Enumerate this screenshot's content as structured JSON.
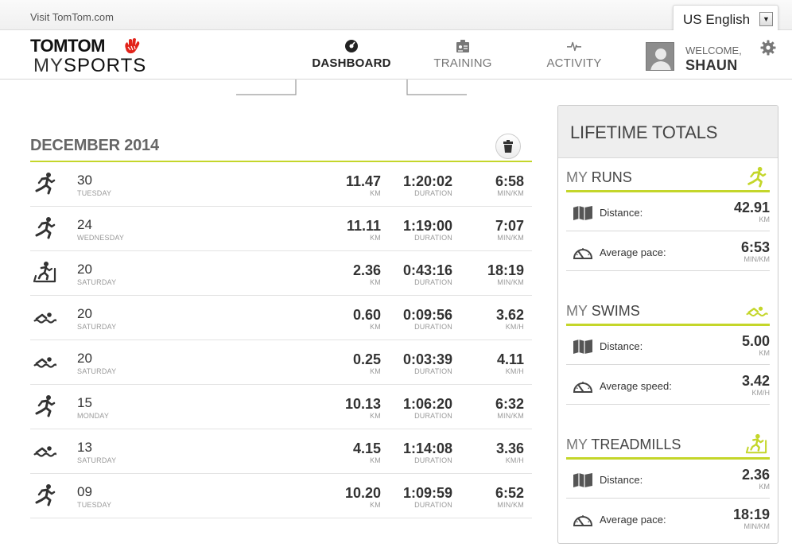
{
  "topbar": {
    "visit_link": "Visit TomTom.com",
    "language": "US English"
  },
  "logo": {
    "brand": "TOMTOM",
    "product_prefix": "MY",
    "product_suffix": "SPORTS"
  },
  "nav": {
    "tabs": [
      {
        "label": "DASHBOARD",
        "icon": "dashboard-icon",
        "active": true
      },
      {
        "label": "TRAINING",
        "icon": "training-icon",
        "active": false
      },
      {
        "label": "ACTIVITY",
        "icon": "activity-icon",
        "active": false
      }
    ]
  },
  "user": {
    "welcome": "WELCOME,",
    "name": "SHAUN"
  },
  "month": {
    "title": "DECEMBER 2014"
  },
  "activities": [
    {
      "type": "run",
      "day": "30",
      "weekday": "TUESDAY",
      "distance": "11.47",
      "distance_unit": "KM",
      "duration": "1:20:02",
      "duration_unit": "DURATION",
      "pace": "6:58",
      "pace_unit": "MIN/KM"
    },
    {
      "type": "run",
      "day": "24",
      "weekday": "WEDNESDAY",
      "distance": "11.11",
      "distance_unit": "KM",
      "duration": "1:19:00",
      "duration_unit": "DURATION",
      "pace": "7:07",
      "pace_unit": "MIN/KM"
    },
    {
      "type": "treadmill",
      "day": "20",
      "weekday": "SATURDAY",
      "distance": "2.36",
      "distance_unit": "KM",
      "duration": "0:43:16",
      "duration_unit": "DURATION",
      "pace": "18:19",
      "pace_unit": "MIN/KM"
    },
    {
      "type": "swim",
      "day": "20",
      "weekday": "SATURDAY",
      "distance": "0.60",
      "distance_unit": "KM",
      "duration": "0:09:56",
      "duration_unit": "DURATION",
      "pace": "3.62",
      "pace_unit": "KM/H"
    },
    {
      "type": "swim",
      "day": "20",
      "weekday": "SATURDAY",
      "distance": "0.25",
      "distance_unit": "KM",
      "duration": "0:03:39",
      "duration_unit": "DURATION",
      "pace": "4.11",
      "pace_unit": "KM/H"
    },
    {
      "type": "run",
      "day": "15",
      "weekday": "MONDAY",
      "distance": "10.13",
      "distance_unit": "KM",
      "duration": "1:06:20",
      "duration_unit": "DURATION",
      "pace": "6:32",
      "pace_unit": "MIN/KM"
    },
    {
      "type": "swim",
      "day": "13",
      "weekday": "SATURDAY",
      "distance": "4.15",
      "distance_unit": "KM",
      "duration": "1:14:08",
      "duration_unit": "DURATION",
      "pace": "3.36",
      "pace_unit": "KM/H"
    },
    {
      "type": "run",
      "day": "09",
      "weekday": "TUESDAY",
      "distance": "10.20",
      "distance_unit": "KM",
      "duration": "1:09:59",
      "duration_unit": "DURATION",
      "pace": "6:52",
      "pace_unit": "MIN/KM"
    }
  ],
  "lifetime": {
    "title": "LIFETIME TOTALS",
    "runs": {
      "prefix": "MY",
      "name": "RUNS",
      "distance_label": "Distance:",
      "distance": "42.91",
      "distance_unit": "KM",
      "second_label": "Average pace:",
      "second": "6:53",
      "second_unit": "MIN/KM"
    },
    "swims": {
      "prefix": "MY",
      "name": "SWIMS",
      "distance_label": "Distance:",
      "distance": "5.00",
      "distance_unit": "KM",
      "second_label": "Average speed:",
      "second": "3.42",
      "second_unit": "KM/H"
    },
    "treadmills": {
      "prefix": "MY",
      "name": "TREADMILLS",
      "distance_label": "Distance:",
      "distance": "2.36",
      "distance_unit": "KM",
      "second_label": "Average pace:",
      "second": "18:19",
      "second_unit": "MIN/KM"
    }
  },
  "colors": {
    "accent": "#c4d62a",
    "brand_red": "#e2231a"
  }
}
